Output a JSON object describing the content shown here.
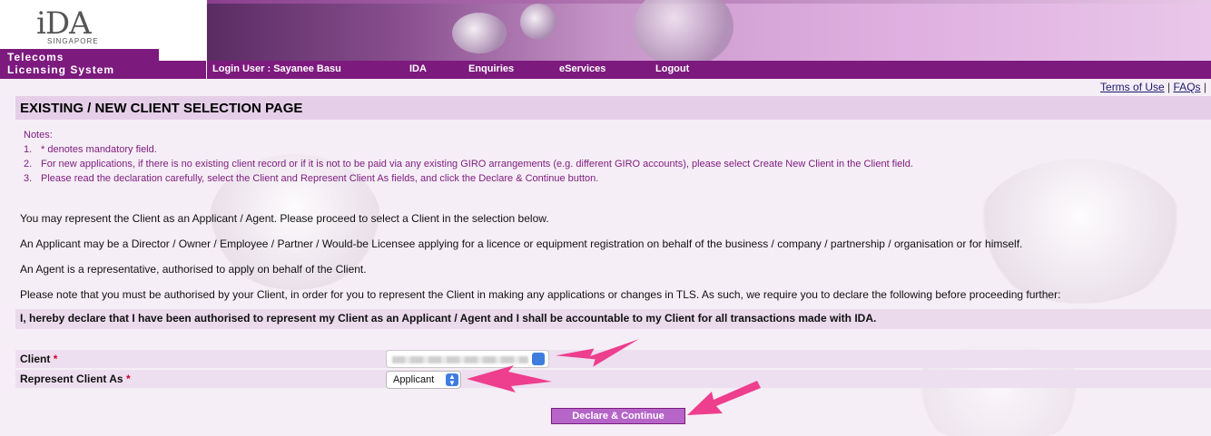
{
  "header": {
    "logo_text": "iDA",
    "logo_sub": "SINGAPORE",
    "system_line1": "Telecoms",
    "system_line2": "Licensing System",
    "login_user": "Login User : Sayanee Basu",
    "nav": [
      "IDA",
      "Enquiries",
      "eServices",
      "Logout"
    ]
  },
  "top_links": {
    "terms": "Terms of Use",
    "sep": "|",
    "faqs": "FAQs",
    "end": "|"
  },
  "page_title": "EXISTING / NEW CLIENT SELECTION PAGE",
  "notes": {
    "heading": "Notes:",
    "items": [
      {
        "num": "1.",
        "text": "* denotes mandatory field."
      },
      {
        "num": "2.",
        "text": "For new applications, if there is no existing client record or if it is not to be paid via any existing GIRO arrangements (e.g. different GIRO accounts), please select Create New Client in the Client field."
      },
      {
        "num": "3.",
        "text": "Please read the declaration carefully, select the Client and Represent Client As fields, and click the Declare & Continue button."
      }
    ]
  },
  "paragraphs": [
    "You may represent the Client as an Applicant / Agent. Please proceed to select a Client in the selection below.",
    "An Applicant may be a Director / Owner / Employee / Partner / Would-be Licensee applying for a licence or equipment registration on behalf of the business / company / partnership / organisation or for himself.",
    "An Agent is a representative, authorised to apply on behalf of the Client.",
    "Please note that you must be authorised by your Client, in order for you to represent the Client in making any applications or changes in TLS. As such, we require you to declare the following before proceeding further:"
  ],
  "declaration": "I, hereby declare that I have been authorised to represent my Client as an Applicant / Agent and I shall be accountable to my Client for all transactions made with IDA.",
  "form": {
    "client_label": "Client",
    "represent_label": "Represent Client As",
    "required_mark": "*",
    "represent_value": "Applicant"
  },
  "submit_label": "Declare & Continue",
  "colors": {
    "brand_purple": "#7c1a7e",
    "light_purple": "#e5cfe8",
    "arrow_pink": "#ee3e8e"
  }
}
